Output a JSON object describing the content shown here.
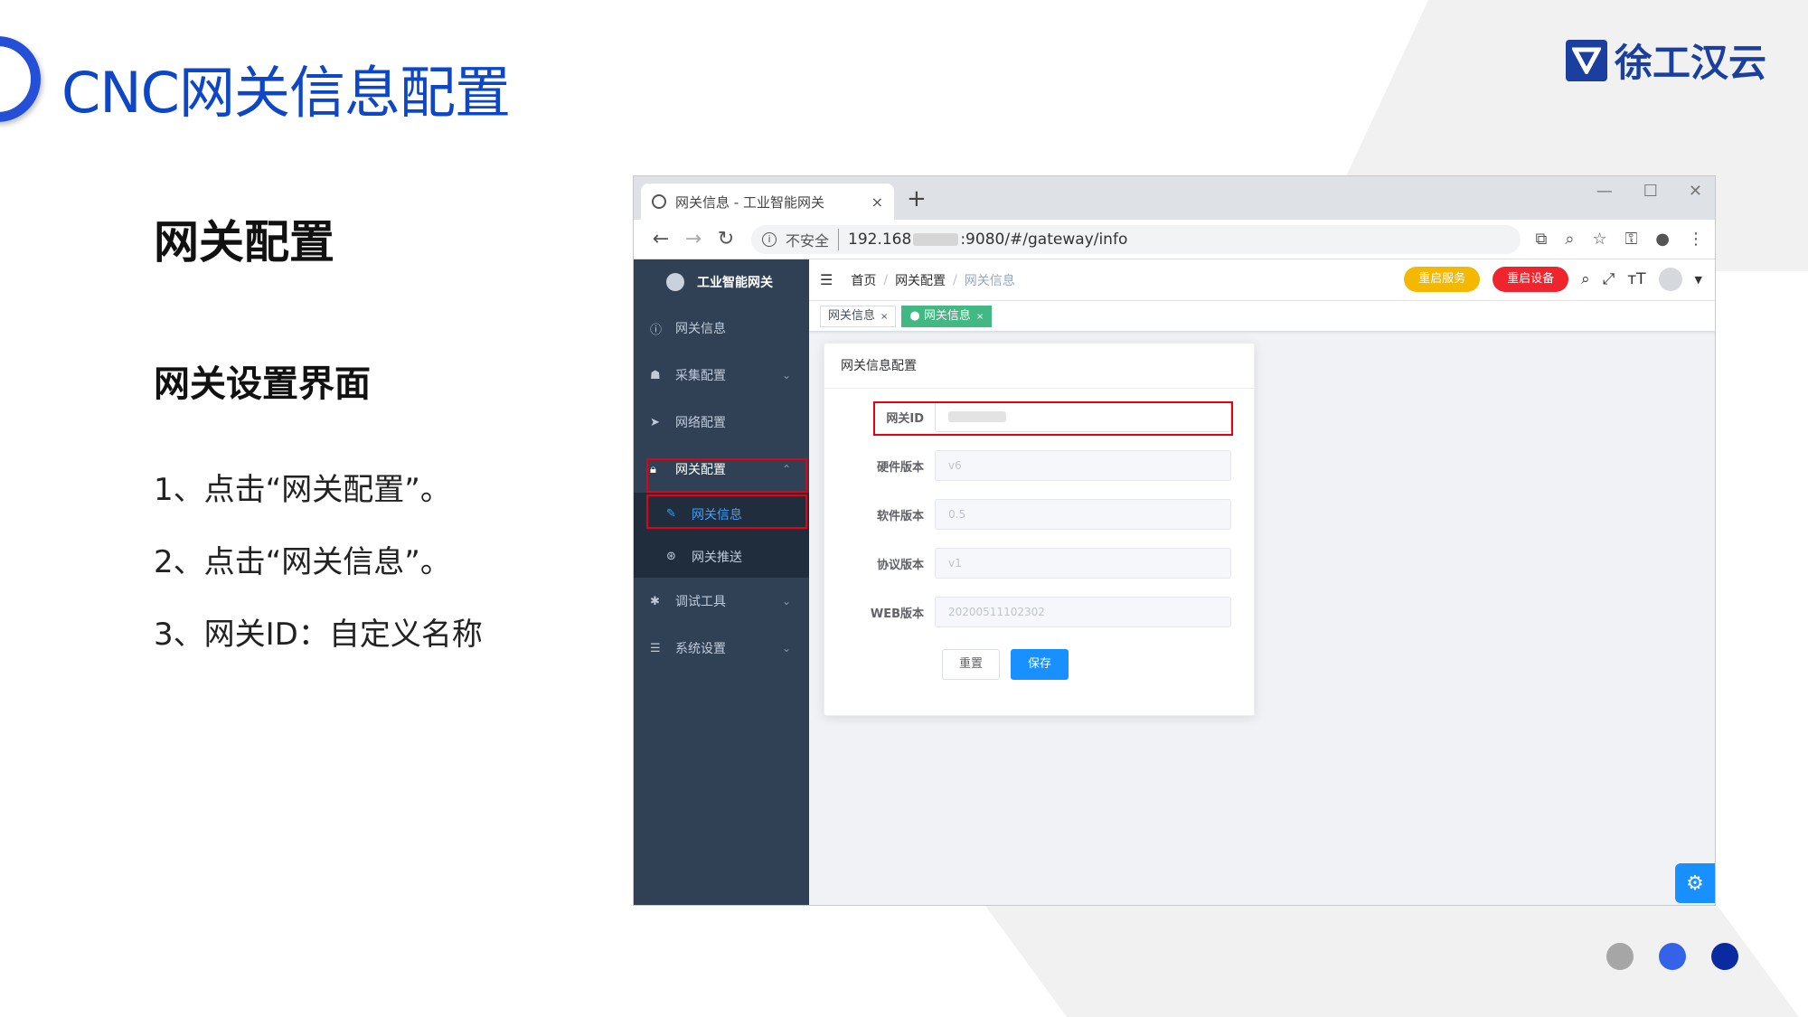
{
  "slide": {
    "title": "CNC网关信息配置",
    "brand": "徐工汉云",
    "heading": "网关配置",
    "subheading": "网关设置界面",
    "steps": [
      "1、点击“网关配置”。",
      "2、点击“网关信息”。",
      "3、网关ID：自定义名称"
    ],
    "dot_colors": [
      "#a6a6a6",
      "#3462e8",
      "#0a2aa0"
    ]
  },
  "browser": {
    "tab_title": "网关信息 - 工业智能网关",
    "tab_close": "×",
    "new_tab": "+",
    "window_controls": [
      "—",
      "☐",
      "✕"
    ],
    "insecure_label": "不安全",
    "url_prefix": "192.168",
    "url_suffix": ":9080/#/gateway/info"
  },
  "app": {
    "brand": "工业智能网关",
    "sidebar": {
      "items": [
        {
          "label": "网关信息",
          "icon": "info-icon"
        },
        {
          "label": "采集配置",
          "icon": "collect-icon"
        },
        {
          "label": "网络配置",
          "icon": "send-icon"
        },
        {
          "label": "网关配置",
          "icon": "lock-icon"
        },
        {
          "label": "调试工具",
          "icon": "debug-icon"
        },
        {
          "label": "系统设置",
          "icon": "list-icon"
        }
      ],
      "sub_items": [
        {
          "label": "网关信息",
          "icon": "edit-icon"
        },
        {
          "label": "网关推送",
          "icon": "push-icon"
        }
      ]
    },
    "breadcrumb": [
      "首页",
      "网关配置",
      "网关信息"
    ],
    "breadcrumb_sep": "/",
    "buttons": {
      "restart_service": "重启服务",
      "restart_device": "重启设备"
    },
    "tags": [
      {
        "label": "网关信息"
      },
      {
        "label": "网关信息"
      }
    ],
    "tag_close": "×",
    "card": {
      "title": "网关信息配置",
      "fields": [
        {
          "label": "网关ID",
          "value": ""
        },
        {
          "label": "硬件版本",
          "value": "v6"
        },
        {
          "label": "软件版本",
          "value": "0.5"
        },
        {
          "label": "协议版本",
          "value": "v1"
        },
        {
          "label": "WEB版本",
          "value": "20200511102302"
        }
      ],
      "reset_label": "重置",
      "save_label": "保存"
    },
    "colors": {
      "sidebar": "#304156",
      "accent": "#1890ff",
      "tag_active": "#42b983",
      "warn": "#f5b800",
      "danger": "#f0242c",
      "highlight": "#e60012"
    }
  }
}
